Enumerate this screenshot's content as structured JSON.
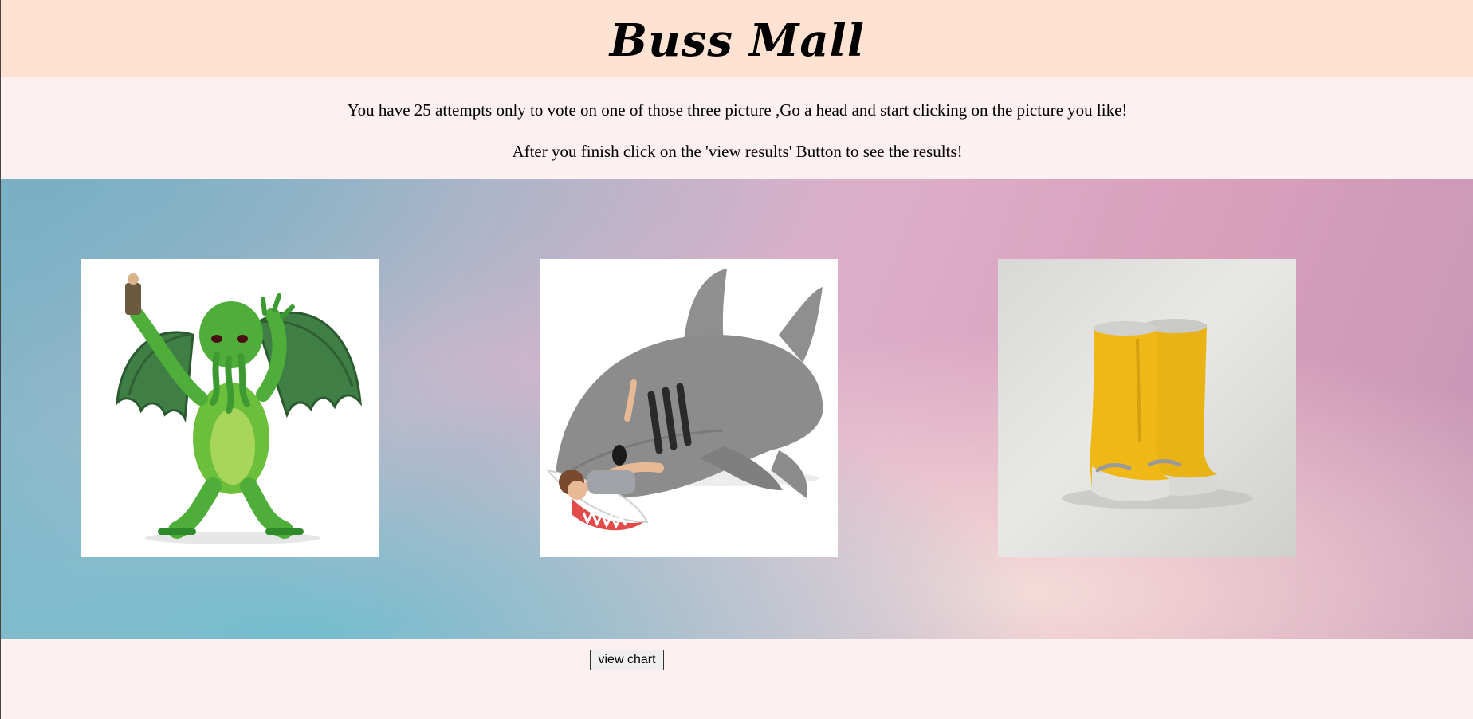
{
  "header": {
    "title": "Buss Mall"
  },
  "intro": {
    "line1": "You have 25 attempts only to vote on one of those three picture ,Go a head and start clicking on the picture you like!",
    "line2": "After you finish click on the 'view results' Button to see the results!"
  },
  "products": [
    {
      "name": "cthulhu"
    },
    {
      "name": "shark"
    },
    {
      "name": "boots"
    }
  ],
  "actions": {
    "view_chart_label": "view chart"
  },
  "colors": {
    "header_bg": "#ffe2d1",
    "page_bg": "#fdf0f0",
    "boots": "#f0b817",
    "shark": "#8c8c8c",
    "cthulhu": "#3aa043"
  }
}
